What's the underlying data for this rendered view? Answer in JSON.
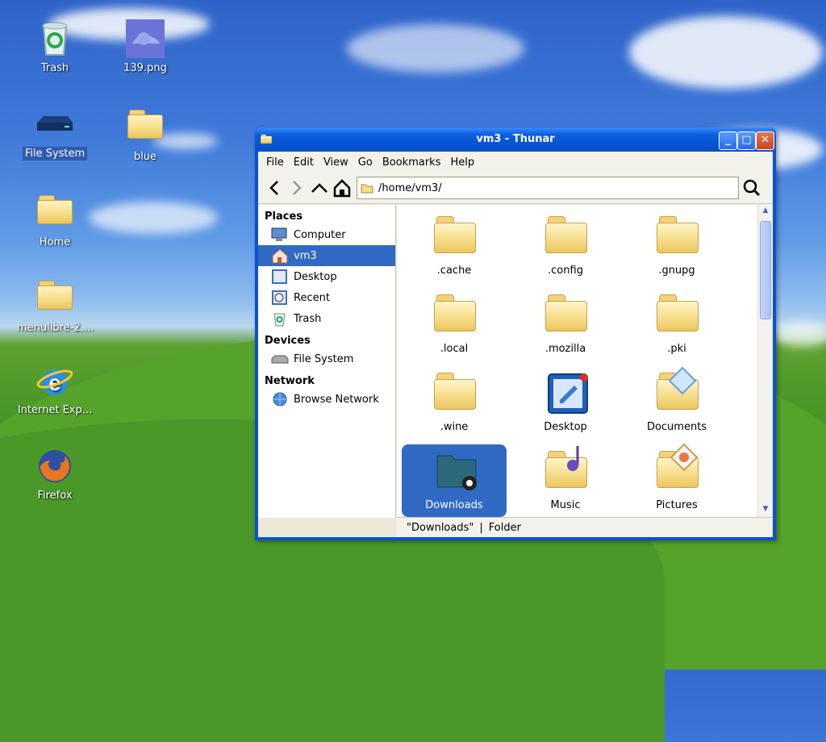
{
  "desktop": {
    "icons": [
      {
        "label": "Trash"
      },
      {
        "label": "139.png"
      },
      {
        "label": "File System"
      },
      {
        "label": "blue"
      },
      {
        "label": "Home"
      },
      {
        "label": "menulibre-2...."
      },
      {
        "label": "Internet Exp..."
      },
      {
        "label": "Firefox"
      }
    ]
  },
  "window": {
    "title": "vm3 - Thunar",
    "buttons": {
      "minimize": "_",
      "maximize": "□",
      "close": "✕"
    },
    "menu": [
      "File",
      "Edit",
      "View",
      "Go",
      "Bookmarks",
      "Help"
    ],
    "path": "/home/vm3/",
    "sidebar": {
      "places_heading": "Places",
      "places": [
        {
          "label": "Computer",
          "icon": "computer-icon"
        },
        {
          "label": "vm3",
          "icon": "home-icon"
        },
        {
          "label": "Desktop",
          "icon": "desktop-icon"
        },
        {
          "label": "Recent",
          "icon": "recent-icon"
        },
        {
          "label": "Trash",
          "icon": "trash-icon"
        }
      ],
      "devices_heading": "Devices",
      "devices": [
        {
          "label": "File System",
          "icon": "drive-icon"
        }
      ],
      "network_heading": "Network",
      "network": [
        {
          "label": "Browse Network",
          "icon": "network-icon"
        }
      ]
    },
    "files": [
      {
        "label": ".cache"
      },
      {
        "label": ".config"
      },
      {
        "label": ".gnupg"
      },
      {
        "label": ".local"
      },
      {
        "label": ".mozilla"
      },
      {
        "label": ".pki"
      },
      {
        "label": ".wine"
      },
      {
        "label": "Desktop"
      },
      {
        "label": "Documents"
      },
      {
        "label": "Downloads"
      },
      {
        "label": "Music"
      },
      {
        "label": "Pictures"
      }
    ],
    "status": {
      "name": "\"Downloads\"",
      "separator": "|",
      "type": "Folder"
    }
  }
}
